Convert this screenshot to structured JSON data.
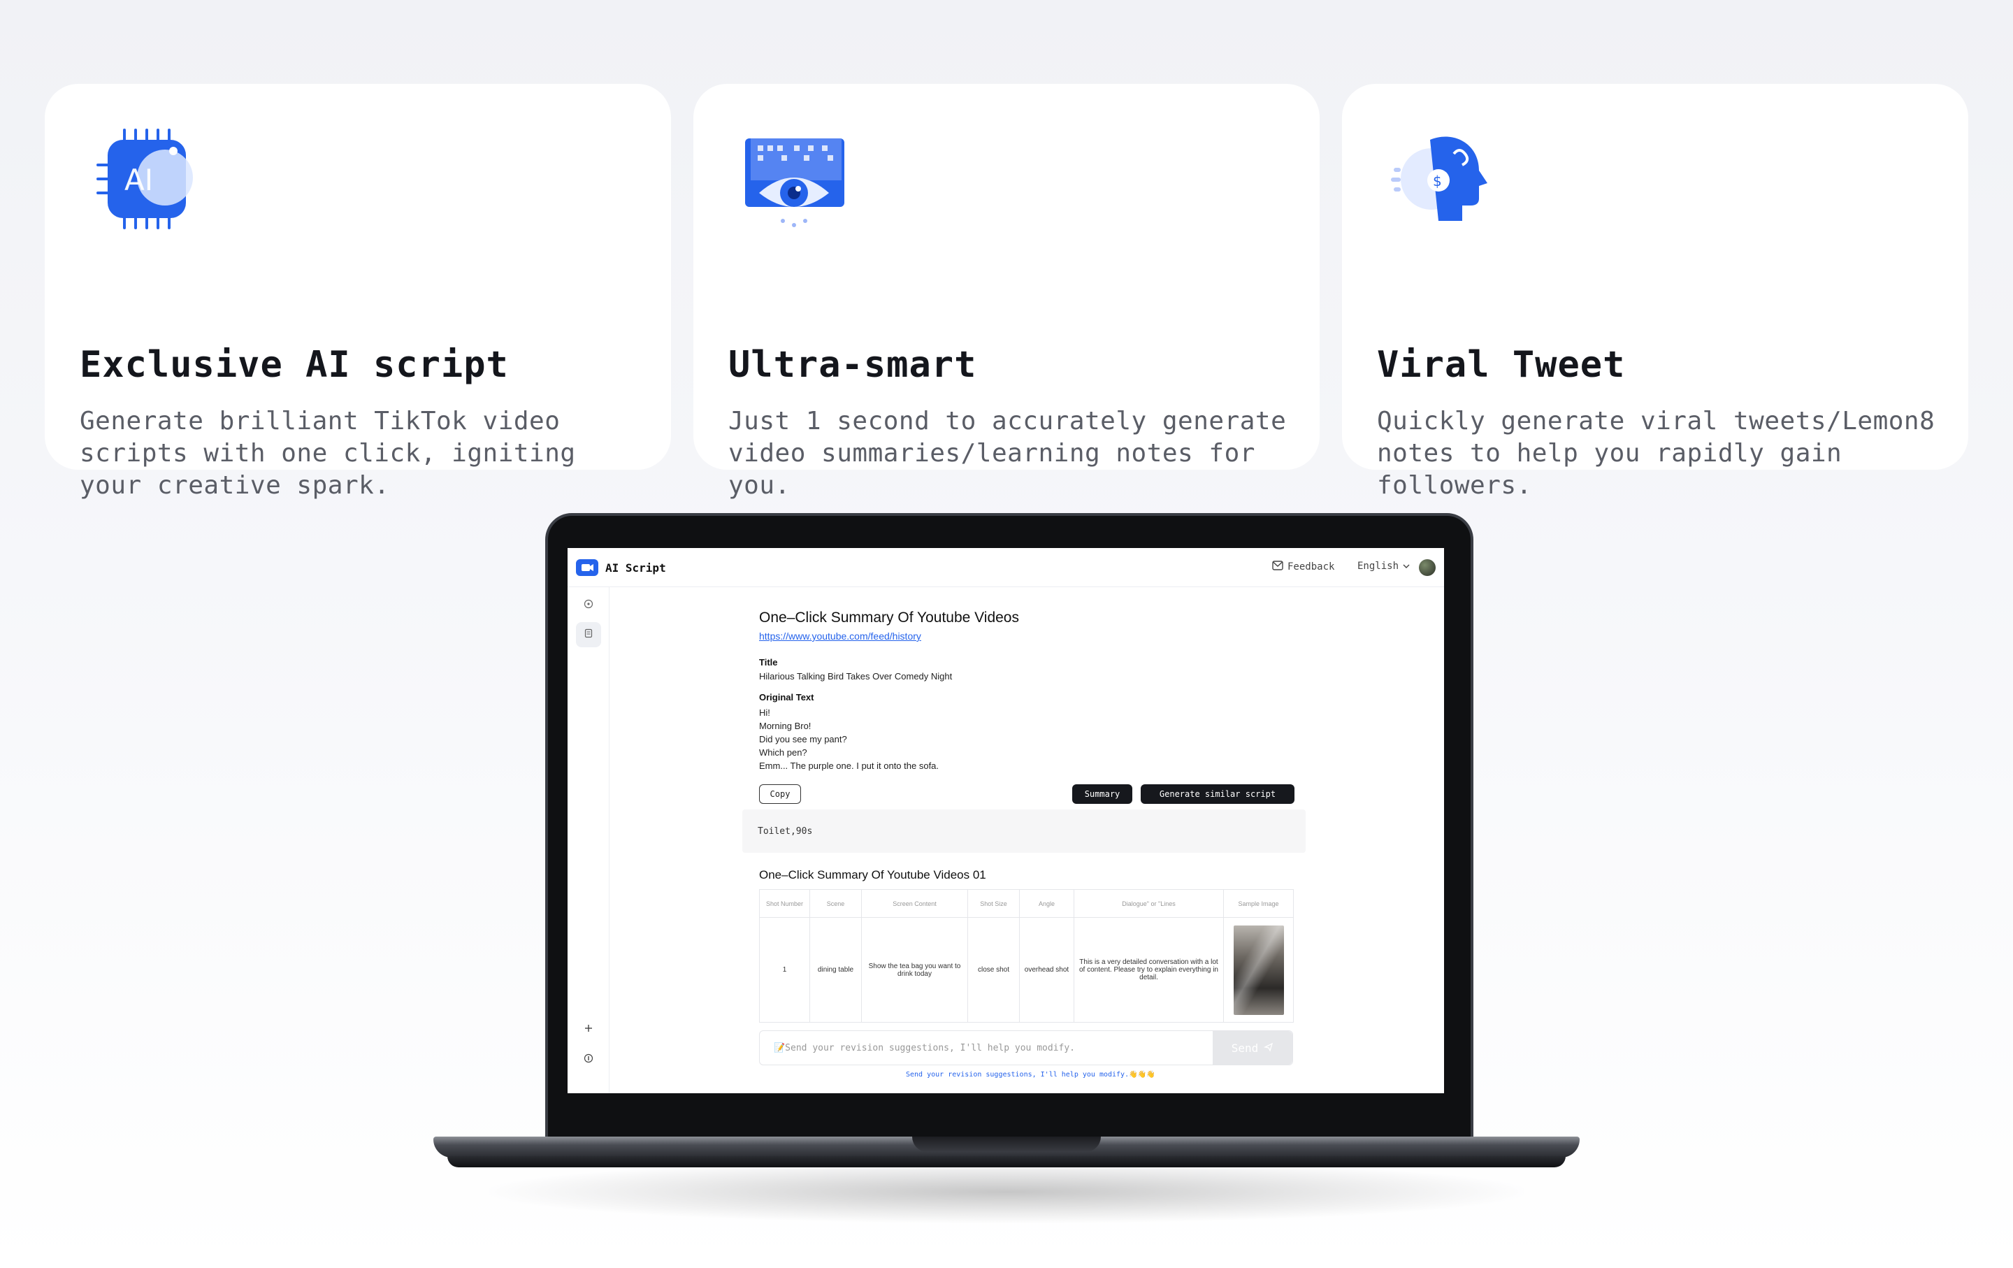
{
  "features": [
    {
      "icon": "ai-chip-icon",
      "title": "Exclusive AI script",
      "description": "Generate brilliant TikTok video scripts with one click, igniting your creative spark."
    },
    {
      "icon": "eye-screen-icon",
      "title": "Ultra-smart",
      "description": "Just 1 second to accurately generate video summaries/learning notes for you."
    },
    {
      "icon": "head-profile-icon",
      "title": "Viral Tweet",
      "description": "Quickly generate viral tweets/Lemon8 notes to help you rapidly gain followers."
    }
  ],
  "app": {
    "name": "AI Script",
    "header": {
      "feedback": "Feedback",
      "language": "English"
    },
    "sidebar": {
      "items": [
        {
          "icon": "compass-icon"
        },
        {
          "icon": "document-icon"
        },
        {
          "icon": "plus-icon"
        },
        {
          "icon": "info-icon"
        }
      ]
    },
    "summary": {
      "heading": "One–Click Summary Of Youtube Videos",
      "url": "https://www.youtube.com/feed/history",
      "title_label": "Title",
      "title_value": "Hilarious Talking Bird Takes Over Comedy Night",
      "original_label": "Original Text",
      "original_lines": [
        "Hi!",
        "Morning Bro!",
        "Did you see my pant?",
        "Which pen?",
        "Emm... The purple one. I put it onto the sofa."
      ],
      "copy_label": "Copy",
      "summary_label": "Summary",
      "similar_label": "Generate similar script"
    },
    "prompt": "Toilet,90s",
    "result": {
      "heading": "One–Click Summary Of Youtube Videos 01",
      "columns": [
        "Shot Number",
        "Scene",
        "Screen Content",
        "Shot Size",
        "Angle",
        "Dialogue\" or \"Lines",
        "Sample Image"
      ],
      "rows": [
        {
          "shot": "1",
          "scene": "dining table",
          "content": "Show the tea bag you want to drink today",
          "size": "close shot",
          "angle": "overhead shot",
          "dialogue": "This is a very detailed conversation with a lot of content. Please try to explain everything in detail."
        }
      ]
    },
    "input": {
      "placeholder": "📝Send your revision suggestions, I'll help you modify.",
      "send_label": "Send",
      "hint": "Send your revision suggestions, I'll help you modify.👋👋👋"
    }
  },
  "colors": {
    "accent": "#2563eb",
    "dark_button": "#16181d",
    "card_bg": "#ffffff"
  }
}
